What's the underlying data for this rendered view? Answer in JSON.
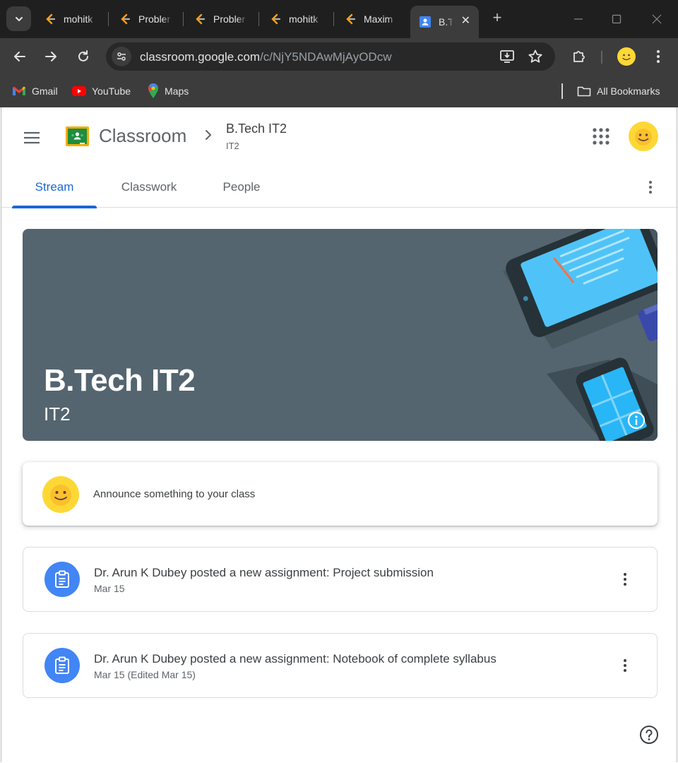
{
  "browser": {
    "tabs": [
      {
        "title": "mohitk",
        "favicon": "leetcode-icon"
      },
      {
        "title": "Probler",
        "favicon": "leetcode-icon"
      },
      {
        "title": "Probler",
        "favicon": "leetcode-icon"
      },
      {
        "title": "mohitk",
        "favicon": "leetcode-icon"
      },
      {
        "title": "Maxim",
        "favicon": "leetcode-icon"
      },
      {
        "title": "B.T",
        "favicon": "classroom-icon",
        "active": true
      }
    ],
    "url_host": "classroom.google.com",
    "url_path": "/c/NjY5NDAwMjAyODcw",
    "bookmarks": [
      {
        "label": "Gmail",
        "icon": "gmail-icon"
      },
      {
        "label": "YouTube",
        "icon": "youtube-icon"
      },
      {
        "label": "Maps",
        "icon": "maps-icon"
      }
    ],
    "all_bookmarks": "All Bookmarks"
  },
  "app": {
    "brand": "Classroom",
    "class_title": "B.Tech IT2",
    "class_section": "IT2"
  },
  "nav_tabs": [
    {
      "label": "Stream",
      "active": true
    },
    {
      "label": "Classwork"
    },
    {
      "label": "People"
    }
  ],
  "banner": {
    "title": "B.Tech IT2",
    "subtitle": "IT2",
    "bg_color": "#546570"
  },
  "announce": {
    "placeholder": "Announce something to your class"
  },
  "stream": [
    {
      "title": "Dr. Arun K Dubey posted a new assignment: Project submission",
      "date": "Mar 15",
      "icon": "assignment-icon"
    },
    {
      "title": "Dr. Arun K Dubey posted a new assignment: Notebook of complete syllabus",
      "date": "Mar 15 (Edited Mar 15)",
      "icon": "assignment-icon"
    }
  ],
  "colors": {
    "accent": "#1967d2",
    "assignment_icon_bg": "#4285f4",
    "chrome_bg": "#1f1f1f",
    "toolbar_bg": "#3c3c3c"
  }
}
